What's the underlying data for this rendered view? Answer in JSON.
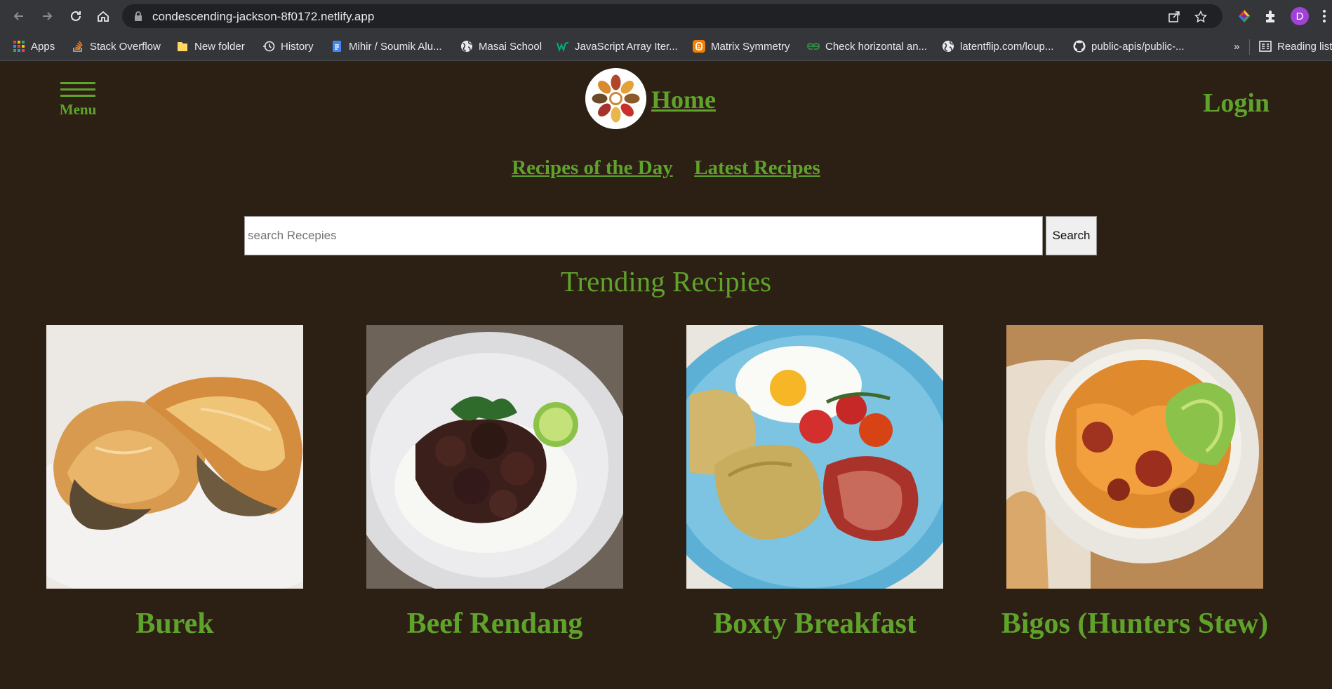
{
  "browser": {
    "url": "condescending-jackson-8f0172.netlify.app",
    "profile_initial": "D",
    "bookmarks": [
      {
        "label": "Apps",
        "icon": "apps-grid-icon"
      },
      {
        "label": "Stack Overflow",
        "icon": "stackoverflow-icon"
      },
      {
        "label": "New folder",
        "icon": "folder-icon"
      },
      {
        "label": "History",
        "icon": "history-icon"
      },
      {
        "label": "Mihir / Soumik Alu...",
        "icon": "docs-icon"
      },
      {
        "label": "Masai School",
        "icon": "globe-icon"
      },
      {
        "label": "JavaScript Array Iter...",
        "icon": "w3-icon"
      },
      {
        "label": "Matrix Symmetry",
        "icon": "blogger-icon"
      },
      {
        "label": "Check horizontal an...",
        "icon": "gfg-icon"
      },
      {
        "label": "latentflip.com/loup...",
        "icon": "globe-icon"
      },
      {
        "label": "public-apis/public-...",
        "icon": "github-icon"
      }
    ],
    "overflow_label": "»",
    "reading_list_label": "Reading list"
  },
  "header": {
    "menu_label": "Menu",
    "home_label": "Home",
    "login_label": "Login"
  },
  "sub_nav": {
    "recipes_of_day": "Recipes of the Day",
    "latest_recipes": "Latest Recipes"
  },
  "search": {
    "placeholder": "search Recepies",
    "button_label": "Search"
  },
  "trending": {
    "title": "Trending Recipies",
    "recipes": [
      {
        "name": "Burek"
      },
      {
        "name": "Beef Rendang"
      },
      {
        "name": "Boxty Breakfast"
      },
      {
        "name": "Bigos (Hunters Stew)"
      }
    ]
  },
  "colors": {
    "accent_green": "#5fa32c",
    "page_background": "#2c1f13"
  }
}
